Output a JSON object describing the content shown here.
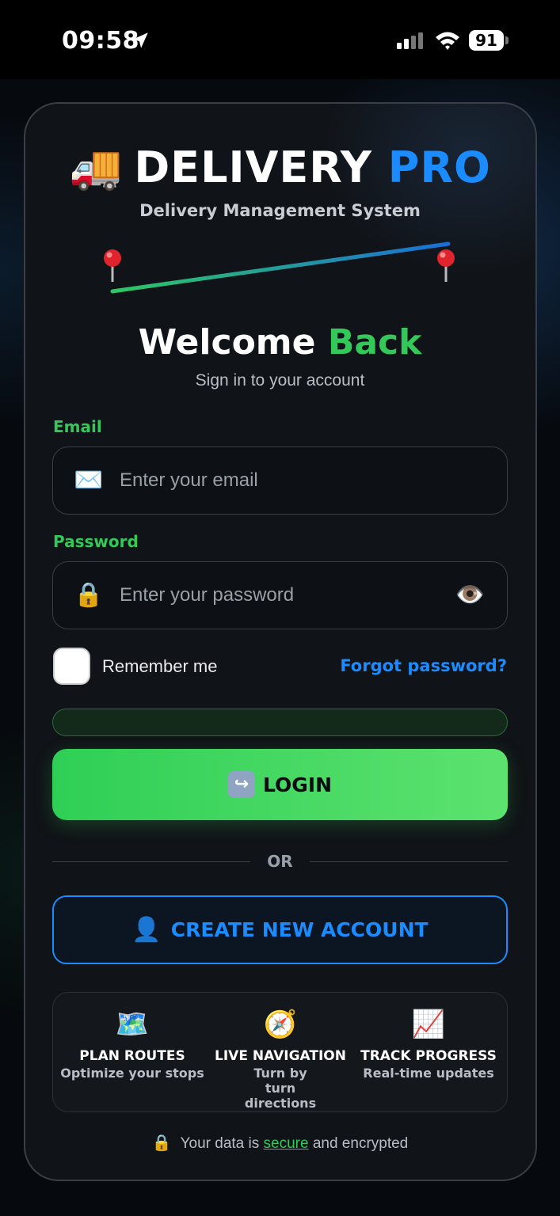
{
  "status_bar": {
    "time": "09:58",
    "battery": "91",
    "icons": [
      "location-arrow-icon",
      "signal-icon",
      "wifi-icon",
      "battery-icon"
    ]
  },
  "brand": {
    "truck_emoji": "🚚",
    "name_main": "DELIVERY",
    "name_accent": "PRO",
    "subtitle": "Delivery Management System",
    "accent_color": "#1a8cff"
  },
  "welcome": {
    "title_main": "Welcome",
    "title_accent": "Back",
    "subtitle": "Sign in to your account",
    "accent_color": "#34c759"
  },
  "form": {
    "email_label": "Email",
    "email_icon": "✉️",
    "email_placeholder": "Enter your email",
    "email_value": "",
    "password_label": "Password",
    "password_icon": "🔒",
    "password_placeholder": "Enter your password",
    "password_value": "",
    "eye_icon": "👁️",
    "remember_label": "Remember me",
    "remember_checked": false,
    "forgot_label": "Forgot password?",
    "progress_fraction": 0
  },
  "actions": {
    "login_icon": "↪",
    "login_label": "LOGIN",
    "or_text": "OR",
    "create_icon": "👤",
    "create_label": "CREATE NEW ACCOUNT"
  },
  "features": [
    {
      "icon": "🗺️",
      "title": "PLAN ROUTES",
      "desc": "Optimize your stops"
    },
    {
      "icon": "🧭",
      "title": "LIVE NAVIGATION",
      "desc": "Turn by turn directions"
    },
    {
      "icon": "📈",
      "title": "TRACK PROGRESS",
      "desc": "Real-time updates"
    }
  ],
  "footer": {
    "lock_icon": "🔒",
    "text_before": "Your data is",
    "link": "secure",
    "text_after": "and encrypted"
  },
  "colors": {
    "green": "#34c759",
    "blue": "#1a8cff",
    "card_bg": "#101317"
  }
}
